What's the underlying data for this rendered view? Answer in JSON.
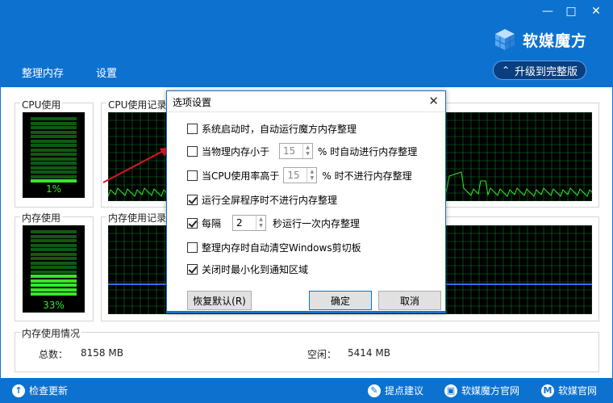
{
  "window": {
    "minimize_glyph": "—",
    "restore_glyph": "□",
    "close_glyph": "✕"
  },
  "brand": {
    "name": "软媒魔方"
  },
  "upgrade": {
    "label": "升级到完整版",
    "chevron": "≫"
  },
  "nav": {
    "tabs": [
      "整理内存",
      "设置"
    ]
  },
  "cpu": {
    "title": "CPU使用",
    "percent_text": "1%",
    "level": 0.01,
    "history_title": "CPU使用记录"
  },
  "memory": {
    "title": "内存使用",
    "percent_text": "33%",
    "level": 0.33,
    "history_title": "内存使用记录"
  },
  "mem_status": {
    "title": "内存使用情况",
    "total_label": "总数：",
    "total_value": "8158 MB",
    "free_label": "空闲：",
    "free_value": "5414 MB"
  },
  "footer": {
    "check_update": "检查更新",
    "suggestion": "提点建议",
    "official_site": "软媒魔方官网",
    "ruanmei_site": "软媒官网"
  },
  "dialog": {
    "title": "选项设置",
    "close_glyph": "✕",
    "options": [
      {
        "label": "系统启动时，自动运行魔方内存整理",
        "checked": false
      },
      {
        "prefix": "当物理内存小于",
        "value": "15",
        "suffix": "% 时自动进行内存整理",
        "checked": false
      },
      {
        "prefix": "当CPU使用率高于",
        "value": "15",
        "suffix": "% 时不进行内存整理",
        "checked": false
      },
      {
        "label": "运行全屏程序时不进行内存整理",
        "checked": true
      },
      {
        "prefix": "每隔",
        "value": "2",
        "suffix": "秒运行一次内存整理",
        "checked": true
      },
      {
        "label": "整理内存时自动清空Windows剪切板",
        "checked": false
      },
      {
        "label": "关闭时最小化到通知区域",
        "checked": true
      }
    ],
    "restore_default": "恢复默认(R)",
    "ok": "确定",
    "cancel": "取消"
  },
  "colors": {
    "header_blue": "#0d72cf",
    "meter_green": "#38e62a",
    "grid_green": "#0a7a2a",
    "arrow_red": "#e0141e"
  }
}
